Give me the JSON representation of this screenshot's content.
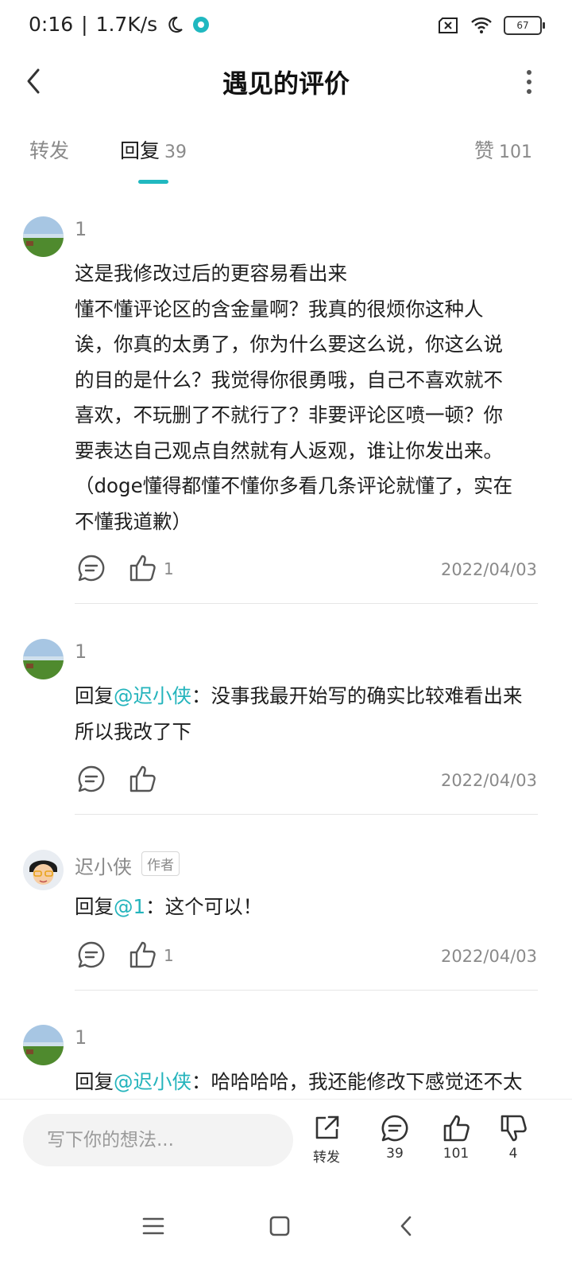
{
  "status_bar": {
    "time": "0:16",
    "speed": "1.7K/s",
    "battery": "67"
  },
  "header": {
    "title": "遇见的评价"
  },
  "tabs": {
    "repost": {
      "label": "转发"
    },
    "reply": {
      "label": "回复",
      "count": "39"
    },
    "like": {
      "label": "赞",
      "count": "101"
    }
  },
  "comments": [
    {
      "username": "1",
      "lines": [
        "这是我修改过后的更容易看出来",
        "懂不懂评论区的含金量啊？我真的很烦你这种人",
        "诶，你真的太勇了，你为什么要这么说，你这么说",
        "的目的是什么？我觉得你很勇哦，自己不喜欢就不",
        "喜欢，不玩删了不就行了？非要评论区喷一顿？你",
        "要表达自己观点自然就有人返观，谁让你发出来。",
        "（doge懂得都懂不懂你多看几条评论就懂了，实在",
        "不懂我道歉）"
      ],
      "likes": "1",
      "date": "2022/04/03"
    },
    {
      "username": "1",
      "reply_prefix": "回复",
      "mention": "@迟小侠",
      "text_line1": "：没事我最开始写的确实比较难看出来",
      "text_line2": "所以我改了下",
      "date": "2022/04/03"
    },
    {
      "username": "迟小侠",
      "tag": "作者",
      "reply_prefix": "回复",
      "mention": "@1",
      "text_line1": "：这个可以！",
      "likes": "1",
      "date": "2022/04/03"
    },
    {
      "username": "1",
      "reply_prefix": "回复",
      "mention": "@迟小侠",
      "text_line1": "：哈哈哈哈，我还能修改下感觉还不太"
    }
  ],
  "bottom_bar": {
    "input_placeholder": "写下你的想法...",
    "repost_label": "转发",
    "reply_count": "39",
    "like_count": "101",
    "dislike_count": "4"
  },
  "colors": {
    "accent": "#20b8c0",
    "mention": "#24b4bc",
    "muted": "#8a8a8a"
  }
}
